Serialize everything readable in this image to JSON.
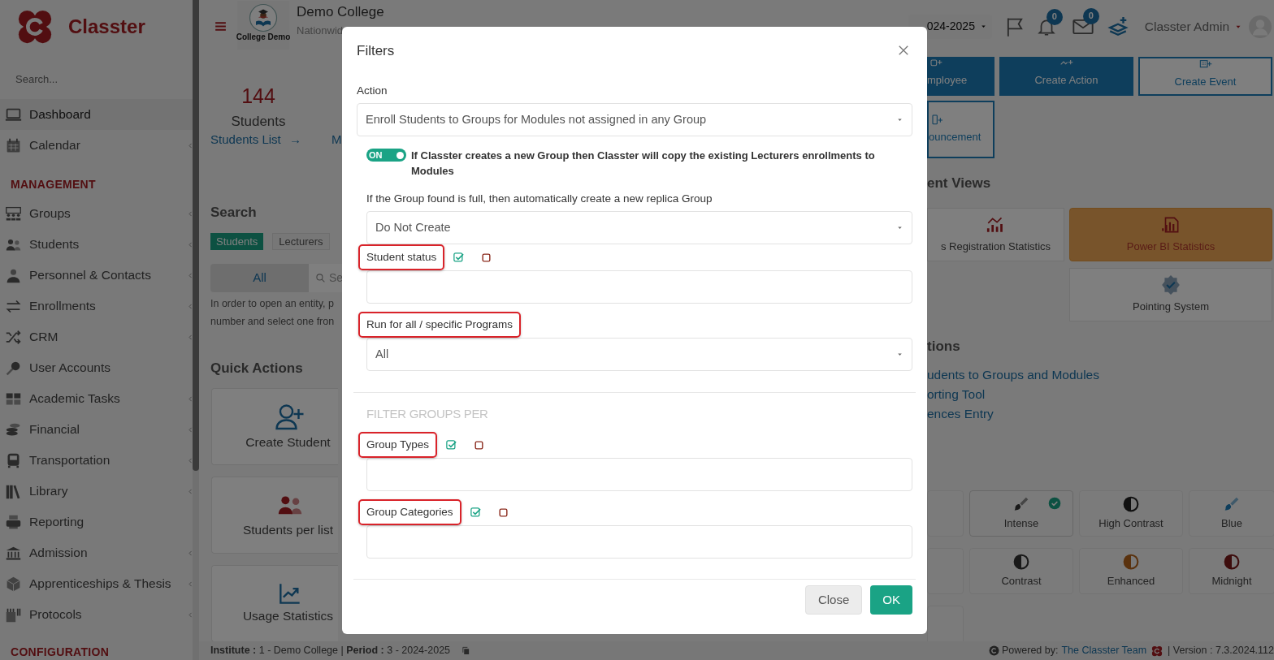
{
  "sidebar": {
    "brand": "Classter",
    "search_placeholder": "Search...",
    "sections": [
      {
        "items": [
          {
            "label": "Dashboard",
            "selected": true,
            "submenu": false
          },
          {
            "label": "Calendar",
            "selected": false,
            "submenu": true
          }
        ]
      },
      {
        "title": "MANAGEMENT",
        "items": [
          {
            "label": "Groups",
            "selected": false,
            "submenu": true
          },
          {
            "label": "Students",
            "selected": false,
            "submenu": true
          },
          {
            "label": "Personnel & Contacts",
            "selected": false,
            "submenu": true
          },
          {
            "label": "Enrollments",
            "selected": false,
            "submenu": true
          },
          {
            "label": "CRM",
            "selected": false,
            "submenu": true
          },
          {
            "label": "User Accounts",
            "selected": false,
            "submenu": false
          },
          {
            "label": "Academic Tasks",
            "selected": false,
            "submenu": true
          },
          {
            "label": "Financial",
            "selected": false,
            "submenu": true
          },
          {
            "label": "Transportation",
            "selected": false,
            "submenu": true
          },
          {
            "label": "Library",
            "selected": false,
            "submenu": true
          },
          {
            "label": "Reporting",
            "selected": false,
            "submenu": false
          },
          {
            "label": "Admission",
            "selected": false,
            "submenu": true
          },
          {
            "label": "Apprenticeships & Thesis",
            "selected": false,
            "submenu": true
          },
          {
            "label": "Protocols",
            "selected": false,
            "submenu": true
          }
        ]
      },
      {
        "title": "CONFIGURATION"
      }
    ]
  },
  "header": {
    "logo_caption": "College Demo",
    "title": "Demo College",
    "subtitle": "Nationwid",
    "period": "024-2025",
    "notifications": "0",
    "messages": "0",
    "user": "Classter Admin"
  },
  "stats": [
    {
      "value": "144",
      "label": "Students",
      "link": "Students List",
      "arrow": "→"
    },
    {
      "link": "M"
    }
  ],
  "search": {
    "title": "Search",
    "tabs": [
      {
        "label": "Students",
        "selected": true
      },
      {
        "label": "Lecturers",
        "selected": false
      }
    ],
    "scope": "All",
    "placeholder": "Se",
    "help_lines": [
      "In order to open an entity, p",
      "number and select one fron"
    ]
  },
  "quick_actions": {
    "title": "Quick Actions",
    "cards": [
      {
        "label": "Create Student"
      },
      {
        "label": "Students per list"
      },
      {
        "label": "Usage Statistics"
      }
    ]
  },
  "action_cards": [
    {
      "label": "mployee",
      "kind": "filled"
    },
    {
      "label": "Create Action",
      "kind": "filled"
    },
    {
      "label": "Create Event",
      "kind": "outline"
    },
    {
      "label": "ouncement",
      "kind": "outline"
    }
  ],
  "views": {
    "title": "ent Views",
    "cards": [
      {
        "label": "s Registration Statistics",
        "highlighted": false
      },
      {
        "label": "Power BI Statistics",
        "highlighted": true
      },
      {
        "label": "Pointing System",
        "highlighted": false
      }
    ]
  },
  "actions": {
    "title": "tions",
    "links": [
      "udents to Groups and Modules",
      "orting Tool",
      "ences Entry"
    ]
  },
  "themes": [
    {
      "selected": false
    },
    {
      "label": "Intense",
      "selected": true
    },
    {
      "label": "High Contrast",
      "selected": false
    },
    {
      "label": "Blue",
      "selected": false
    },
    {
      "selected": false
    },
    {
      "label": "Contrast",
      "selected": false
    },
    {
      "label": "Enhanced",
      "selected": false
    },
    {
      "label": "Midnight",
      "selected": false
    },
    {
      "selected": false
    }
  ],
  "footer": {
    "info": "**Institute :** 1 - Demo College | **Period :** 3 - 2024-2025",
    "powered": "Powered by:",
    "team": "The Classter Team",
    "version": "| Version : 7.3.2024.112"
  },
  "modal": {
    "title": "Filters",
    "fields": [
      {
        "kind": "select",
        "label": "Action",
        "value": "Enroll Students to Groups for Modules not assigned in any Group",
        "highlighted": false
      },
      {
        "kind": "toggle",
        "on": true,
        "switch_label": "ON",
        "text": "If Classter creates a new Group then Classter will copy the existing Lecturers enrollments to Modules"
      },
      {
        "kind": "select",
        "label": "If the Group found is full, then automatically create a new replica Group",
        "value": "Do Not Create",
        "highlighted": false
      },
      {
        "kind": "multiselect",
        "label": "Student status",
        "highlighted": true
      },
      {
        "kind": "select",
        "label": "Run for all / specific Programs",
        "value": "All",
        "highlighted": true
      },
      {
        "kind": "section",
        "title": "FILTER GROUPS PER"
      },
      {
        "kind": "multiselect",
        "label": "Group Types",
        "highlighted": true
      },
      {
        "kind": "multiselect",
        "label": "Group Categories",
        "highlighted": true
      }
    ],
    "buttons": [
      {
        "label": "Close",
        "kind": "secondary"
      },
      {
        "label": "OK",
        "kind": "primary"
      }
    ]
  }
}
